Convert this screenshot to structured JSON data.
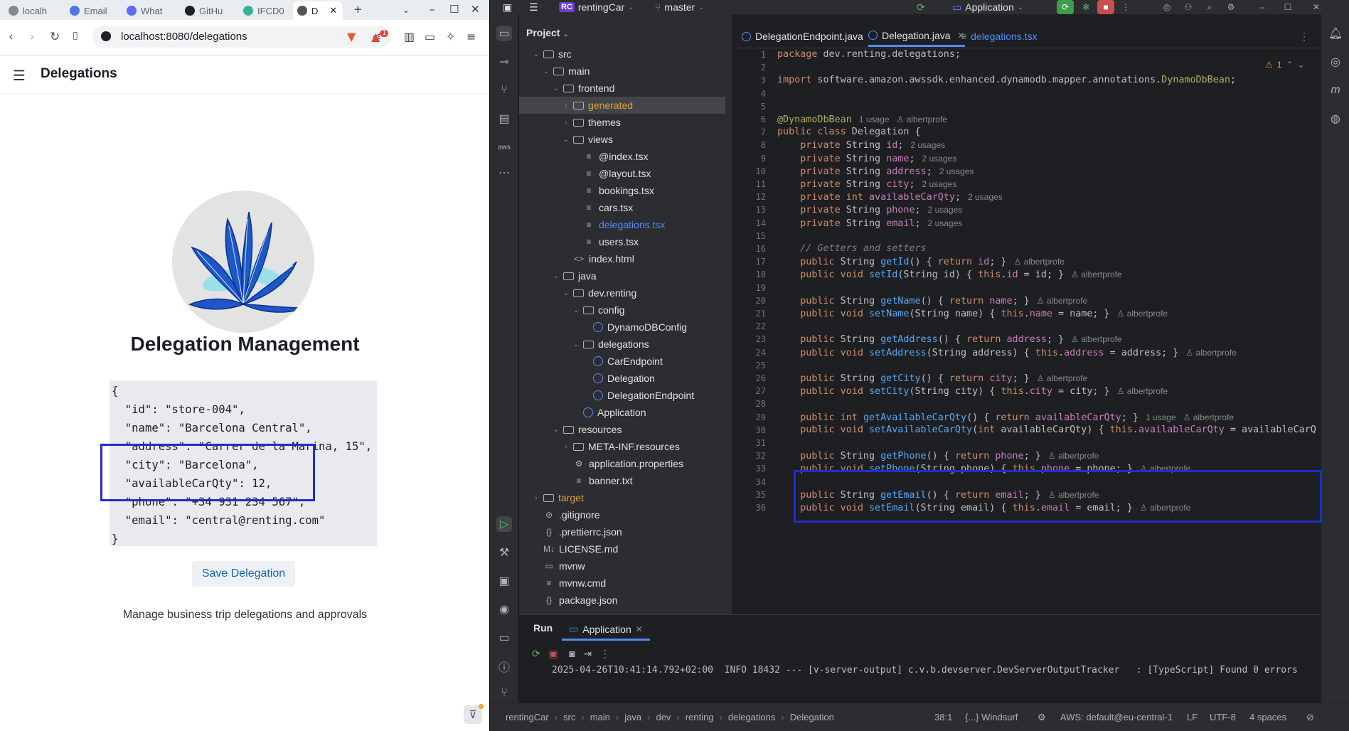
{
  "browser": {
    "tabs": [
      {
        "label": "localh",
        "color": "#888888"
      },
      {
        "label": "Email",
        "color": "#4a76e8"
      },
      {
        "label": "What",
        "color": "#5b6df0"
      },
      {
        "label": "GitHu",
        "color": "#222222"
      },
      {
        "label": "IFCD0",
        "color": "#3ab29b"
      },
      {
        "label": "D",
        "color": "#555555",
        "active": true
      }
    ],
    "url": "localhost:8080/delegations",
    "notification_count": "1"
  },
  "app": {
    "header_title": "Delegations",
    "heading": "Delegation Management",
    "json_text": "{\n  \"id\": \"store-004\",\n  \"name\": \"Barcelona Central\",\n  \"address\": \"Carrer de la Marina, 15\",\n  \"city\": \"Barcelona\",\n  \"availableCarQty\": 12,\n  \"phone\": \"+34 931 234 567\",\n  \"email\": \"central@renting.com\"\n}",
    "save_label": "Save Delegation",
    "subtitle": "Manage business trip delegations and approvals"
  },
  "ide": {
    "project_badge": "RC",
    "project_name": "rentingCar",
    "branch": "master",
    "run_config": "Application",
    "project_panel_title": "Project",
    "tree": [
      {
        "label": "src",
        "depth": 1,
        "arrow": "open",
        "kind": "folder"
      },
      {
        "label": "main",
        "depth": 2,
        "arrow": "open",
        "kind": "folder"
      },
      {
        "label": "frontend",
        "depth": 3,
        "arrow": "open",
        "kind": "folder"
      },
      {
        "label": "generated",
        "depth": 4,
        "arrow": "closed",
        "kind": "folder",
        "style": "orange",
        "selected": true
      },
      {
        "label": "themes",
        "depth": 4,
        "arrow": "closed",
        "kind": "folder"
      },
      {
        "label": "views",
        "depth": 4,
        "arrow": "open",
        "kind": "folder"
      },
      {
        "label": "@index.tsx",
        "depth": 5,
        "kind": "file"
      },
      {
        "label": "@layout.tsx",
        "depth": 5,
        "kind": "file"
      },
      {
        "label": "bookings.tsx",
        "depth": 5,
        "kind": "file"
      },
      {
        "label": "cars.tsx",
        "depth": 5,
        "kind": "file"
      },
      {
        "label": "delegations.tsx",
        "depth": 5,
        "kind": "file",
        "style": "blue"
      },
      {
        "label": "users.tsx",
        "depth": 5,
        "kind": "file"
      },
      {
        "label": "index.html",
        "depth": 4,
        "kind": "html"
      },
      {
        "label": "java",
        "depth": 3,
        "arrow": "open",
        "kind": "folder"
      },
      {
        "label": "dev.renting",
        "depth": 4,
        "arrow": "open",
        "kind": "folder"
      },
      {
        "label": "config",
        "depth": 5,
        "arrow": "open",
        "kind": "folder"
      },
      {
        "label": "DynamoDBConfig",
        "depth": 6,
        "kind": "class"
      },
      {
        "label": "delegations",
        "depth": 5,
        "arrow": "open",
        "kind": "folder"
      },
      {
        "label": "CarEndpoint",
        "depth": 6,
        "kind": "class"
      },
      {
        "label": "Delegation",
        "depth": 6,
        "kind": "class"
      },
      {
        "label": "DelegationEndpoint",
        "depth": 6,
        "kind": "class"
      },
      {
        "label": "Application",
        "depth": 5,
        "kind": "class"
      },
      {
        "label": "resources",
        "depth": 3,
        "arrow": "open",
        "kind": "folder"
      },
      {
        "label": "META-INF.resources",
        "depth": 4,
        "arrow": "closed",
        "kind": "folder"
      },
      {
        "label": "application.properties",
        "depth": 4,
        "kind": "settings"
      },
      {
        "label": "banner.txt",
        "depth": 4,
        "kind": "file"
      },
      {
        "label": "target",
        "depth": 1,
        "arrow": "closed",
        "kind": "folder",
        "style": "orange"
      },
      {
        "label": ".gitignore",
        "depth": 1,
        "kind": "ignore"
      },
      {
        "label": ".prettierrc.json",
        "depth": 1,
        "kind": "json"
      },
      {
        "label": "LICENSE.md",
        "depth": 1,
        "kind": "md"
      },
      {
        "label": "mvnw",
        "depth": 1,
        "kind": "term"
      },
      {
        "label": "mvnw.cmd",
        "depth": 1,
        "kind": "file"
      },
      {
        "label": "package.json",
        "depth": 1,
        "kind": "json"
      }
    ],
    "editor_tabs": [
      {
        "label": "DelegationEndpoint.java",
        "kind": "class"
      },
      {
        "label": "Delegation.java",
        "kind": "class",
        "active": true
      },
      {
        "label": "delegations.tsx",
        "kind": "tsx"
      }
    ],
    "warning_count": "1",
    "code_lines": [
      {
        "n": "1",
        "html": "<span class=\"kw\">package</span> dev.renting.delegations;"
      },
      {
        "n": "2",
        "html": ""
      },
      {
        "n": "3",
        "html": "<span class=\"kw\">import</span> software.amazon.awssdk.enhanced.dynamodb.mapper.annotations.<span class=\"ann\">DynamoDbBean</span>;"
      },
      {
        "n": "4",
        "html": ""
      },
      {
        "n": "5",
        "html": ""
      },
      {
        "n": "6",
        "html": "<span class=\"ann\">@DynamoDbBean</span><span class=\"hint\">1 usage   &#9817; albertprofe</span>"
      },
      {
        "n": "7",
        "html": "<span class=\"kw\">public class</span> Delegation {"
      },
      {
        "n": "8",
        "html": "    <span class=\"kw\">private</span> String <span class=\"fld\">id</span>;<span class=\"hint\">2 usages</span>"
      },
      {
        "n": "9",
        "html": "    <span class=\"kw\">private</span> String <span class=\"fld\">name</span>;<span class=\"hint\">2 usages</span>"
      },
      {
        "n": "10",
        "html": "    <span class=\"kw\">private</span> String <span class=\"fld\">address</span>;<span class=\"hint\">2 usages</span>"
      },
      {
        "n": "11",
        "html": "    <span class=\"kw\">private</span> String <span class=\"fld\">city</span>;<span class=\"hint\">2 usages</span>"
      },
      {
        "n": "12",
        "html": "    <span class=\"kw\">private int</span> <span class=\"fld\">availableCarQty</span>;<span class=\"hint\">2 usages</span>"
      },
      {
        "n": "13",
        "html": "    <span class=\"kw\">private</span> String <span class=\"fld\">phone</span>;<span class=\"hint\">2 usages</span>"
      },
      {
        "n": "14",
        "html": "    <span class=\"kw\">private</span> String <span class=\"fld\">email</span>;<span class=\"hint\">2 usages</span>"
      },
      {
        "n": "15",
        "html": ""
      },
      {
        "n": "16",
        "html": "    <span class=\"cm\">// Getters and setters</span>"
      },
      {
        "n": "17",
        "html": "    <span class=\"kw\">public</span> String <span class=\"fn\">getId</span>() { <span class=\"kw\">return</span> <span class=\"fld\">id</span>; }<span class=\"hint\">&#9817; albertprofe</span>"
      },
      {
        "n": "18",
        "html": "    <span class=\"kw\">public void</span> <span class=\"fn\">setId</span>(String id) { <span class=\"kw\">this</span>.<span class=\"fld\">id</span> = id; }<span class=\"hint\">&#9817; albertprofe</span>"
      },
      {
        "n": "19",
        "html": ""
      },
      {
        "n": "20",
        "html": "    <span class=\"kw\">public</span> String <span class=\"fn\">getName</span>() { <span class=\"kw\">return</span> <span class=\"fld\">name</span>; }<span class=\"hint\">&#9817; albertprofe</span>"
      },
      {
        "n": "21",
        "html": "    <span class=\"kw\">public void</span> <span class=\"fn\">setName</span>(String name) { <span class=\"kw\">this</span>.<span class=\"fld\">name</span> = name; }<span class=\"hint\">&#9817; albertprofe</span>"
      },
      {
        "n": "22",
        "html": ""
      },
      {
        "n": "23",
        "html": "    <span class=\"kw\">public</span> String <span class=\"fn\">getAddress</span>() { <span class=\"kw\">return</span> <span class=\"fld\">address</span>; }<span class=\"hint\">&#9817; albertprofe</span>"
      },
      {
        "n": "24",
        "html": "    <span class=\"kw\">public void</span> <span class=\"fn\">setAddress</span>(String address) { <span class=\"kw\">this</span>.<span class=\"fld\">address</span> = address; }<span class=\"hint\">&#9817; albertprofe</span>"
      },
      {
        "n": "25",
        "html": ""
      },
      {
        "n": "26",
        "html": "    <span class=\"kw\">public</span> String <span class=\"fn\">getCity</span>() { <span class=\"kw\">return</span> <span class=\"fld\">city</span>; }<span class=\"hint\">&#9817; albertprofe</span>"
      },
      {
        "n": "27",
        "html": "    <span class=\"kw\">public void</span> <span class=\"fn\">setCity</span>(String city) { <span class=\"kw\">this</span>.<span class=\"fld\">city</span> = city; }<span class=\"hint\">&#9817; albertprofe</span>"
      },
      {
        "n": "28",
        "html": ""
      },
      {
        "n": "29",
        "html": "    <span class=\"kw\">public int</span> <span class=\"fn\">getAvailableCarQty</span>() { <span class=\"kw\">return</span> <span class=\"fld\">availableCarQty</span>; }<span class=\"hint\">1 usage   &#9817; albertprofe</span>"
      },
      {
        "n": "30",
        "html": "    <span class=\"kw\">public void</span> <span class=\"fn\">setAvailableCarQty</span>(<span class=\"kw\">int</span> availableCarQty) { <span class=\"kw\">this</span>.<span class=\"fld\">availableCarQty</span> = availableCarQ"
      },
      {
        "n": "31",
        "html": ""
      },
      {
        "n": "32",
        "html": "    <span class=\"kw\">public</span> String <span class=\"fn\">getPhone</span>() { <span class=\"kw\">return</span> <span class=\"fld\">phone</span>; }<span class=\"hint\">&#9817; albertprofe</span>"
      },
      {
        "n": "33",
        "html": "    <span class=\"kw\">public void</span> <span class=\"fn\">setPhone</span>(String phone) { <span class=\"kw\">this</span>.<span class=\"fld\">phone</span> = phone; }<span class=\"hint\">&#9817; albertprofe</span>"
      },
      {
        "n": "34",
        "html": ""
      },
      {
        "n": "35",
        "html": "    <span class=\"kw\">public</span> String <span class=\"fn\">getEmail</span>() { <span class=\"kw\">return</span> <span class=\"fld\">email</span>; }<span class=\"hint\">&#9817; albertprofe</span>"
      },
      {
        "n": "36",
        "html": "    <span class=\"kw\">public void</span> <span class=\"fn\">setEmail</span>(String email) { <span class=\"kw\">this</span>.<span class=\"fld\">email</span> = email; }<span class=\"hint\">&#9817; albertprofe</span>"
      }
    ],
    "run_panel": {
      "title": "Run",
      "tab": "Application",
      "log": "2025-04-26T10:41:14.792+02:00  INFO 18432 --- [v-server-output] c.v.b.devserver.DevServerOutputTracker   : [TypeScript] Found 0 errors"
    },
    "status": {
      "breadcrumbs": [
        "rentingCar",
        "src",
        "main",
        "java",
        "dev",
        "renting",
        "delegations",
        "Delegation"
      ],
      "position": "38:1",
      "windsurf": "{...} Windsurf",
      "aws": "AWS: default@eu-central-1",
      "line_sep": "LF",
      "encoding": "UTF-8",
      "indent": "4 spaces"
    }
  },
  "colors": {
    "highlight_box": "#1f2dd2",
    "accent": "#548af7"
  }
}
